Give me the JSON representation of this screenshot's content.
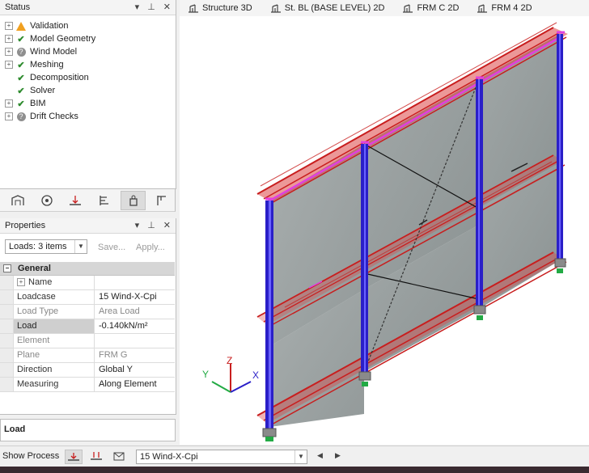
{
  "status": {
    "title": "Status",
    "items": [
      {
        "label": "Validation",
        "state": "warning",
        "expandable": true
      },
      {
        "label": "Model Geometry",
        "state": "ok",
        "expandable": true
      },
      {
        "label": "Wind Model",
        "state": "unknown",
        "expandable": true
      },
      {
        "label": "Meshing",
        "state": "ok",
        "expandable": true
      },
      {
        "label": "Decomposition",
        "state": "ok",
        "expandable": false
      },
      {
        "label": "Solver",
        "state": "ok",
        "expandable": false
      },
      {
        "label": "BIM",
        "state": "ok",
        "expandable": true
      },
      {
        "label": "Drift Checks",
        "state": "unknown",
        "expandable": true
      }
    ]
  },
  "properties": {
    "title": "Properties",
    "selector": "Loads: 3 items",
    "save_label": "Save...",
    "apply_label": "Apply...",
    "section": "General",
    "rows": [
      {
        "name": "Name",
        "value": "",
        "expandable": true
      },
      {
        "name": "Loadcase",
        "value": "15 Wind-X-Cpi"
      },
      {
        "name": "Load Type",
        "value": "Area Load"
      },
      {
        "name": "Load",
        "value": "-0.140kN/m²",
        "selected": true
      },
      {
        "name": "Element",
        "value": ""
      },
      {
        "name": "Plane",
        "value": "FRM G"
      },
      {
        "name": "Direction",
        "value": "Global Y"
      },
      {
        "name": "Measuring",
        "value": "Along Element"
      }
    ],
    "description_title": "Load"
  },
  "tabs": [
    {
      "label": "Structure 3D"
    },
    {
      "label": "St. BL (BASE LEVEL) 2D"
    },
    {
      "label": "FRM C 2D"
    },
    {
      "label": "FRM 4 2D"
    }
  ],
  "axis": {
    "x": "X",
    "y": "Y",
    "z": "Z"
  },
  "bottom": {
    "show_process": "Show Process",
    "loadcase": "15 Wind-X-Cpi"
  },
  "colors": {
    "column": "#2a1fc8",
    "beam": "#c81e1e",
    "brace": "#e040e0",
    "panel": "#7d8585"
  }
}
